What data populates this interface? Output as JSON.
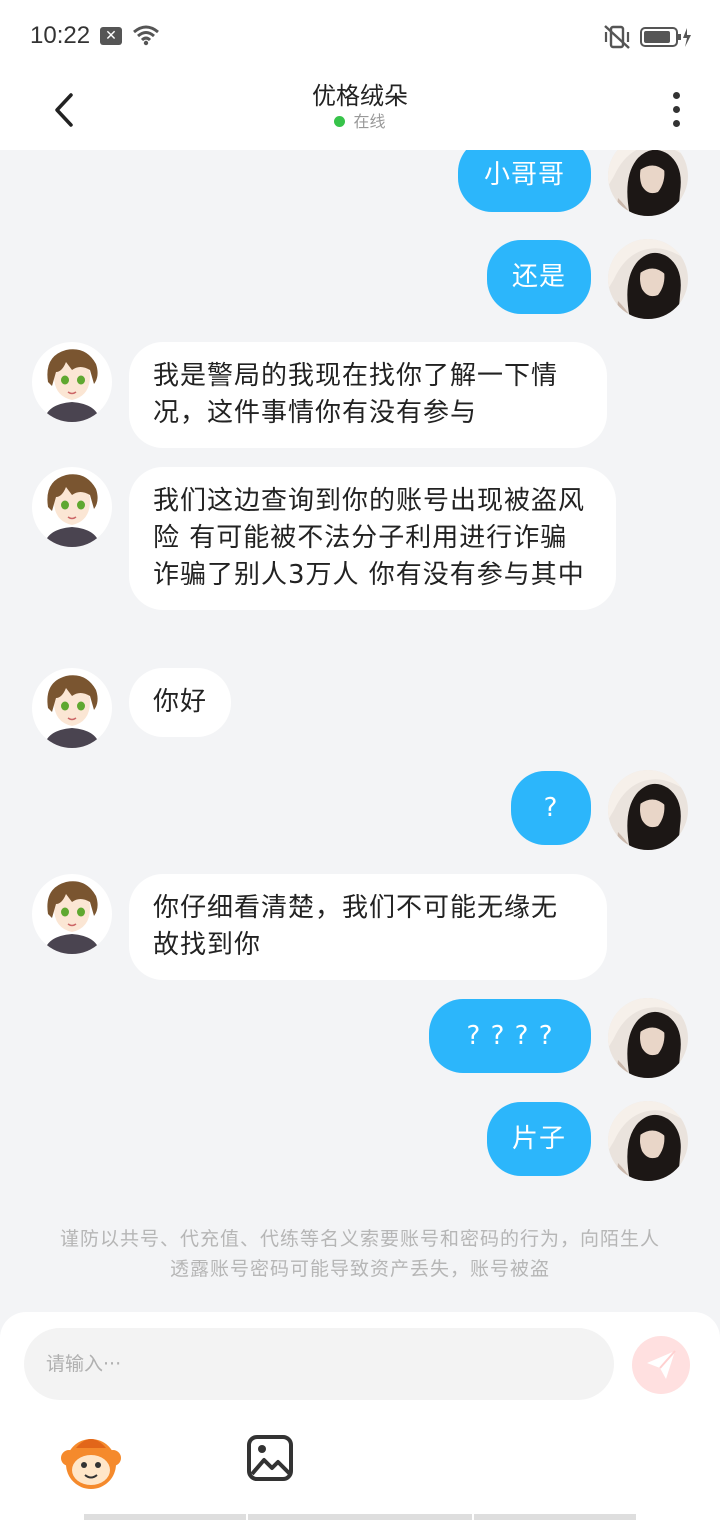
{
  "status": {
    "time": "10:22",
    "notif_icon": "close-box-icon",
    "wifi_icon": "wifi-icon",
    "mute_icon": "vibrate-off-icon",
    "battery_icon": "battery-charging-icon"
  },
  "header": {
    "title": "优格绒朵",
    "status_text": "在线",
    "status_color": "#37c34a",
    "back_icon": "chevron-left-icon",
    "more_icon": "more-vertical-icon"
  },
  "messages": [
    {
      "side": "out",
      "text": "小哥哥"
    },
    {
      "side": "out",
      "text": "还是"
    },
    {
      "side": "in",
      "text": "我是警局的我现在找你了解一下情况，这件事情你有没有参与"
    },
    {
      "side": "in",
      "text": "我们这边查询到你的账号出现被盗风险 有可能被不法分子利用进行诈骗 诈骗了别人3万人 你有没有参与其中"
    },
    {
      "side": "in",
      "text": "你好"
    },
    {
      "side": "out",
      "text": "?"
    },
    {
      "side": "in",
      "text": "你仔细看清楚，我们不可能无缘无故找到你"
    },
    {
      "side": "out",
      "text": "? ? ? ?"
    },
    {
      "side": "out",
      "text": "片子"
    }
  ],
  "notice": "谨防以共号、代充值、代练等名义索要账号和密码的行为，向陌生人透露账号密码可能导致资产丢失，账号被盗",
  "input": {
    "placeholder": "请输入···"
  },
  "toolbar": {
    "send_icon": "paper-plane-icon",
    "emoji_icon": "mascot-face-icon",
    "image_icon": "image-icon"
  },
  "colors": {
    "outgoing_bubble": "#2cb6fb",
    "incoming_bubble": "#ffffff",
    "background": "#f3f4f6"
  }
}
